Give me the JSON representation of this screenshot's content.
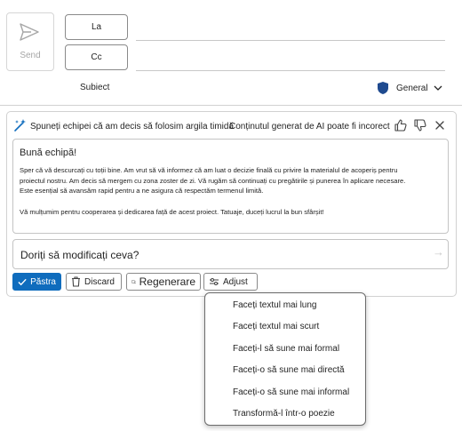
{
  "compose": {
    "send_label": "Send",
    "to_label": "La",
    "cc_label": "Cc",
    "subject_label": "Subiect",
    "sensitivity_label": "General"
  },
  "copilot": {
    "prompt": "Spuneți echipei că am decis să folosim argila timidă",
    "disclaimer": "Conținutul generat de AI poate fi incorect",
    "draft": {
      "greeting": "Bună echipă!",
      "paragraph1": "Sper că vă descurcați cu toții bine. Am vrut să vă informez că am luat o decizie finală cu privire la materialul de acoperiș pentru proiectul nostru. Am decis să mergem cu zona zoster de zi. Vă rugăm să continuați cu pregătirile și punerea în aplicare necesare. Este esențial să avansăm rapid pentru a ne asigura că respectăm termenul limită.",
      "paragraph2": "Vă mulțumim pentru cooperarea și dedicarea față de acest proiect. Tatuaje, duceți lucrul la bun sfârșit!"
    },
    "ask_placeholder": "Doriți să modificați ceva?",
    "buttons": {
      "keep": "Păstra",
      "discard": "Discard",
      "regenerate": "Regenerare",
      "adjust": "Adjust"
    },
    "adjust_menu": [
      "Faceți textul mai lung",
      "Faceți textul mai scurt",
      "Faceți-l să sune mai formal",
      "Faceți-o să sune mai directă",
      "Faceți-o să sune mai informal",
      "Transformă-l într-o poezie"
    ]
  },
  "colors": {
    "accent": "#0f6cbd",
    "shield": "#1f4a8f"
  }
}
